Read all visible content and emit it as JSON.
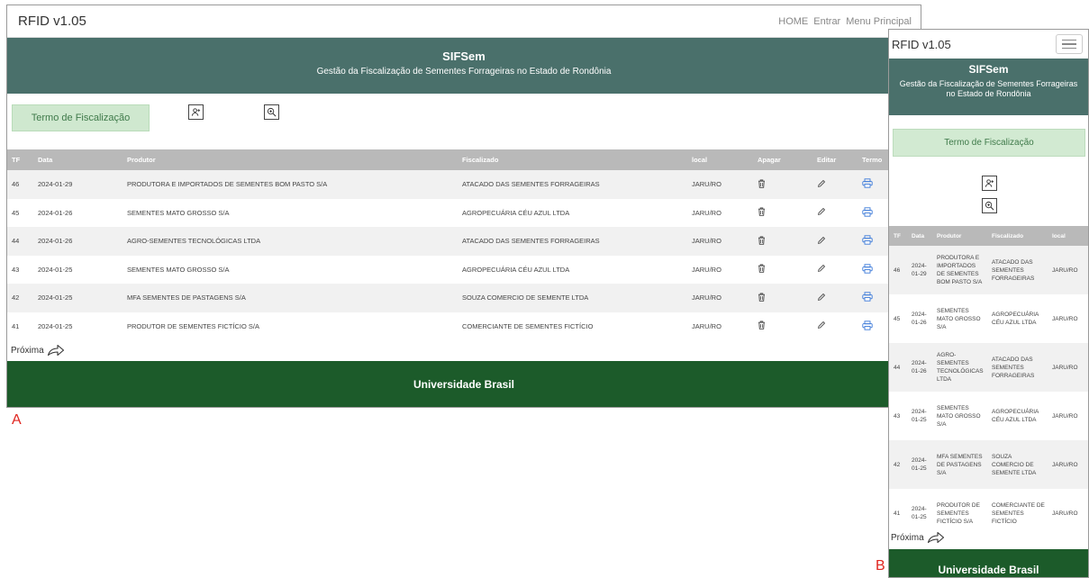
{
  "panel_a": {
    "label": "A",
    "nav": {
      "brand": "RFID v1.05",
      "links": [
        "HOME",
        "Entrar",
        "Menu Principal"
      ]
    },
    "header": {
      "title": "SIFSem",
      "subtitle": "Gestão da Fiscalização de Sementes Forrageiras no Estado de Rondônia"
    },
    "termo_button": "Termo de Fiscalização",
    "table": {
      "columns": [
        "TF",
        "Data",
        "Produtor",
        "Fiscalizado",
        "local",
        "Apagar",
        "Editar",
        "Termo"
      ],
      "rows": [
        {
          "tf": "46",
          "data": "2024-01-29",
          "produtor": "PRODUTORA E IMPORTADOS DE SEMENTES BOM PASTO S/A",
          "fiscalizado": "ATACADO DAS SEMENTES FORRAGEIRAS",
          "local": "JARU/RO"
        },
        {
          "tf": "45",
          "data": "2024-01-26",
          "produtor": "SEMENTES MATO GROSSO S/A",
          "fiscalizado": "AGROPECUÁRIA CÉU AZUL LTDA",
          "local": "JARU/RO"
        },
        {
          "tf": "44",
          "data": "2024-01-26",
          "produtor": "AGRO-SEMENTES TECNOLÓGICAS LTDA",
          "fiscalizado": "ATACADO DAS SEMENTES FORRAGEIRAS",
          "local": "JARU/RO"
        },
        {
          "tf": "43",
          "data": "2024-01-25",
          "produtor": "SEMENTES MATO GROSSO S/A",
          "fiscalizado": "AGROPECUÁRIA CÉU AZUL LTDA",
          "local": "JARU/RO"
        },
        {
          "tf": "42",
          "data": "2024-01-25",
          "produtor": "MFA SEMENTES DE PASTAGENS S/A",
          "fiscalizado": "SOUZA COMERCIO DE SEMENTE LTDA",
          "local": "JARU/RO"
        },
        {
          "tf": "41",
          "data": "2024-01-25",
          "produtor": "PRODUTOR DE SEMENTES FICTÍCIO S/A",
          "fiscalizado": "COMERCIANTE DE SEMENTES FICTÍCIO",
          "local": "JARU/RO"
        }
      ]
    },
    "next_label": "Próxima",
    "footer": "Universidade Brasil"
  },
  "panel_b": {
    "label": "B",
    "nav": {
      "brand": "RFID v1.05"
    },
    "header": {
      "title": "SIFSem",
      "subtitle": "Gestão da Fiscalização de Sementes Forrageiras no Estado de Rondônia"
    },
    "termo_button": "Termo de Fiscalização",
    "table": {
      "columns": [
        "TF",
        "Data",
        "Produtor",
        "Fiscalizado",
        "local"
      ],
      "rows": [
        {
          "tf": "46",
          "data": "2024-01-29",
          "produtor": "PRODUTORA E IMPORTADOS DE SEMENTES BOM PASTO S/A",
          "fiscalizado": "ATACADO DAS SEMENTES FORRAGEIRAS",
          "local": "JARU/RO"
        },
        {
          "tf": "45",
          "data": "2024-01-26",
          "produtor": "SEMENTES MATO GROSSO S/A",
          "fiscalizado": "AGROPECUÁRIA CÉU AZUL LTDA",
          "local": "JARU/RO"
        },
        {
          "tf": "44",
          "data": "2024-01-26",
          "produtor": "AGRO-SEMENTES TECNOLÓGICAS LTDA",
          "fiscalizado": "ATACADO DAS SEMENTES FORRAGEIRAS",
          "local": "JARU/RO"
        },
        {
          "tf": "43",
          "data": "2024-01-25",
          "produtor": "SEMENTES MATO GROSSO S/A",
          "fiscalizado": "AGROPECUÁRIA CÉU AZUL LTDA",
          "local": "JARU/RO"
        },
        {
          "tf": "42",
          "data": "2024-01-25",
          "produtor": "MFA SEMENTES DE PASTAGENS S/A",
          "fiscalizado": "SOUZA COMERCIO DE SEMENTE LTDA",
          "local": "JARU/RO"
        },
        {
          "tf": "41",
          "data": "2024-01-25",
          "produtor": "PRODUTOR DE SEMENTES FICTÍCIO S/A",
          "fiscalizado": "COMERCIANTE DE SEMENTES FICTÍCIO",
          "local": "JARU/RO"
        }
      ]
    },
    "next_label": "Próxima",
    "footer": "Universidade Brasil"
  },
  "colors": {
    "header_bg": "#4a706b",
    "footer_bg": "#1c5b2a",
    "termo_bg": "#cfe8cf",
    "table_header_bg": "#b9b9b9",
    "accent_blue": "#3d7bd9",
    "label_red": "#e0251f"
  },
  "icons": {
    "delete": "trash-icon",
    "edit": "pencil-icon",
    "termo": "printer-icon",
    "add_user": "add-user-icon",
    "search": "zoom-in-icon",
    "next": "share-arrow-icon",
    "menu": "hamburger-icon"
  }
}
